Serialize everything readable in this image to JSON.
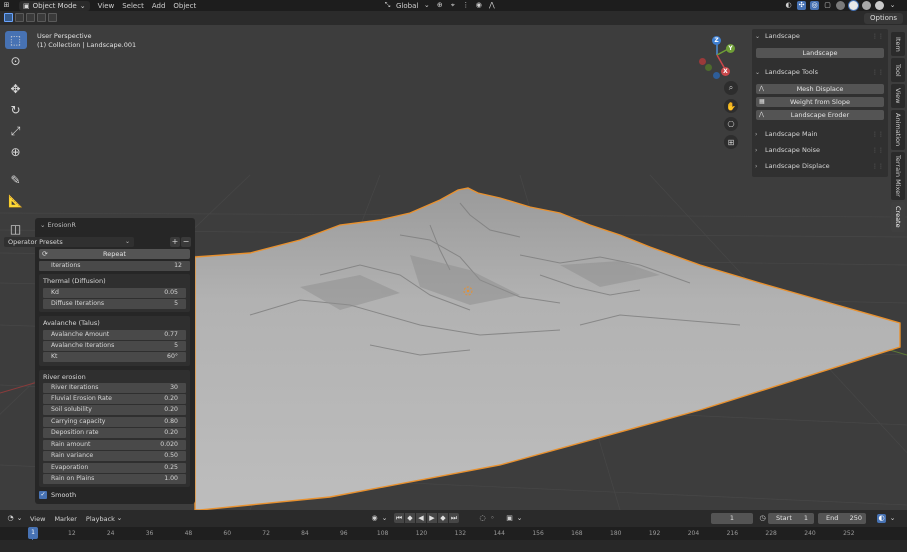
{
  "header": {
    "mode": "Object Mode",
    "menus": [
      "View",
      "Select",
      "Add",
      "Object"
    ],
    "orientation": "Global",
    "options_label": "Options"
  },
  "viewport": {
    "perspective": "User Perspective",
    "collection": "(1) Collection | Landscape.001",
    "gizmo_axes": [
      "Z",
      "Y",
      "X"
    ]
  },
  "toolbar": {
    "tools": [
      "select-box",
      "cursor",
      "move",
      "rotate",
      "scale",
      "transform",
      "annotate",
      "measure",
      "add-cube"
    ]
  },
  "npanel": {
    "landscape_header": "Landscape",
    "landscape_button": "Landscape",
    "tools_header": "Landscape Tools",
    "tools_buttons": [
      "Mesh Displace",
      "Weight from Slope",
      "Landscape Eroder"
    ],
    "collapsed": [
      "Landscape Main",
      "Landscape Noise",
      "Landscape Displace"
    ]
  },
  "tabs": [
    "Item",
    "Tool",
    "View",
    "Animation",
    "Terrain Mixer",
    "Create"
  ],
  "erosion": {
    "title": "ErosionR",
    "presets": "Operator Presets",
    "repeat": "Repeat",
    "iterations": {
      "label": "Iterations",
      "value": "12"
    },
    "thermal": {
      "title": "Thermal (Diffusion)",
      "rows": [
        {
          "label": "Kd",
          "value": "0.05"
        },
        {
          "label": "Diffuse Iterations",
          "value": "5"
        }
      ]
    },
    "avalanche": {
      "title": "Avalanche (Talus)",
      "rows": [
        {
          "label": "Avalanche Amount",
          "value": "0.77"
        },
        {
          "label": "Avalanche Iterations",
          "value": "5"
        },
        {
          "label": "Kt",
          "value": "60°"
        }
      ]
    },
    "river": {
      "title": "River erosion",
      "rows": [
        {
          "label": "River Iterations",
          "value": "30"
        },
        {
          "label": "Fluvial Erosion Rate",
          "value": "0.20"
        },
        {
          "label": "Soil solubility",
          "value": "0.20"
        },
        {
          "label": "Carrying capacity",
          "value": "0.80"
        },
        {
          "label": "Deposition rate",
          "value": "0.20"
        },
        {
          "label": "Rain amount",
          "value": "0.020"
        },
        {
          "label": "Rain variance",
          "value": "0.50"
        },
        {
          "label": "Evaporation",
          "value": "0.25"
        },
        {
          "label": "Rain on Plains",
          "value": "1.00"
        }
      ]
    },
    "smooth": "Smooth"
  },
  "timeline": {
    "menus": [
      "View",
      "Marker",
      "Playback"
    ],
    "current_frame": "1",
    "start_label": "Start",
    "start": "1",
    "end_label": "End",
    "end": "250",
    "ticks": [
      "1",
      "12",
      "24",
      "36",
      "48",
      "60",
      "72",
      "84",
      "96",
      "108",
      "120",
      "132",
      "144",
      "156",
      "168",
      "180",
      "192",
      "204",
      "216",
      "228",
      "240",
      "252"
    ]
  },
  "colors": {
    "accent": "#4772b3",
    "selection_outline": "#e8912f",
    "panel": "#303030",
    "background": "#3d3d3d"
  }
}
